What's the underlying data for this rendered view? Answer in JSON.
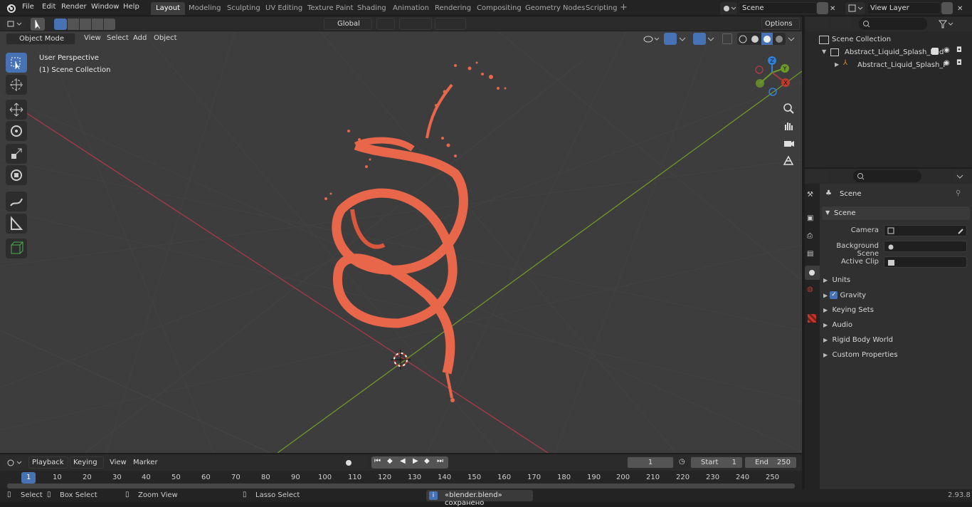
{
  "app": {
    "version": "2.93.8"
  },
  "menu": [
    "File",
    "Edit",
    "Render",
    "Window",
    "Help"
  ],
  "workspaces": {
    "active": "Layout",
    "tabs": [
      "Layout",
      "Modeling",
      "Sculpting",
      "UV Editing",
      "Texture Paint",
      "Shading",
      "Animation",
      "Rendering",
      "Compositing",
      "Geometry Nodes",
      "Scripting"
    ]
  },
  "scene_field": {
    "value": "Scene"
  },
  "view_layer_field": {
    "value": "View Layer"
  },
  "toolbar_header": {
    "transform_orientation": "Global",
    "options_label": "Options"
  },
  "viewport_header": {
    "mode": "Object Mode",
    "menus": [
      "View",
      "Select",
      "Add",
      "Object"
    ]
  },
  "viewport": {
    "overlay_line1": "User Perspective",
    "overlay_line2": "(1) Scene Collection",
    "gizmo_axes": [
      "Z",
      "Y",
      "X"
    ]
  },
  "colors": {
    "accent_blue": "#4772b3",
    "splash_red": "#e8664a",
    "x_axis": "#a83b44",
    "y_axis": "#6c9a28",
    "z_axis": "#2f7fd6"
  },
  "outliner": {
    "root": "Scene Collection",
    "items": [
      {
        "label": "Abstract_Liquid_Splash_Red",
        "level": 1
      },
      {
        "label": "Abstract_Liquid_Splash_F",
        "level": 2
      }
    ]
  },
  "properties": {
    "context_name": "Scene",
    "panel_title": "Scene",
    "fields": [
      {
        "label": "Camera"
      },
      {
        "label": "Background Scene"
      },
      {
        "label": "Active Clip"
      }
    ],
    "subpanels": [
      "Units",
      "Gravity",
      "Keying Sets",
      "Audio",
      "Rigid Body World",
      "Custom Properties"
    ],
    "gravity_checked": true
  },
  "timeline": {
    "menus": [
      "Playback",
      "Keying",
      "View",
      "Marker"
    ],
    "current_frame": "1",
    "start_label": "Start",
    "start_value": "1",
    "end_label": "End",
    "end_value": "250",
    "ruler": [
      "1",
      "10",
      "20",
      "30",
      "40",
      "50",
      "60",
      "70",
      "80",
      "90",
      "100",
      "110",
      "120",
      "130",
      "140",
      "150",
      "160",
      "170",
      "180",
      "190",
      "200",
      "210",
      "220",
      "230",
      "240",
      "250"
    ]
  },
  "statusbar": {
    "select": "Select",
    "box_select": "Box Select",
    "zoom_view": "Zoom View",
    "lasso_select": "Lasso Select",
    "message": "«blender.blend» сохранено",
    "version": "2.93.8"
  }
}
